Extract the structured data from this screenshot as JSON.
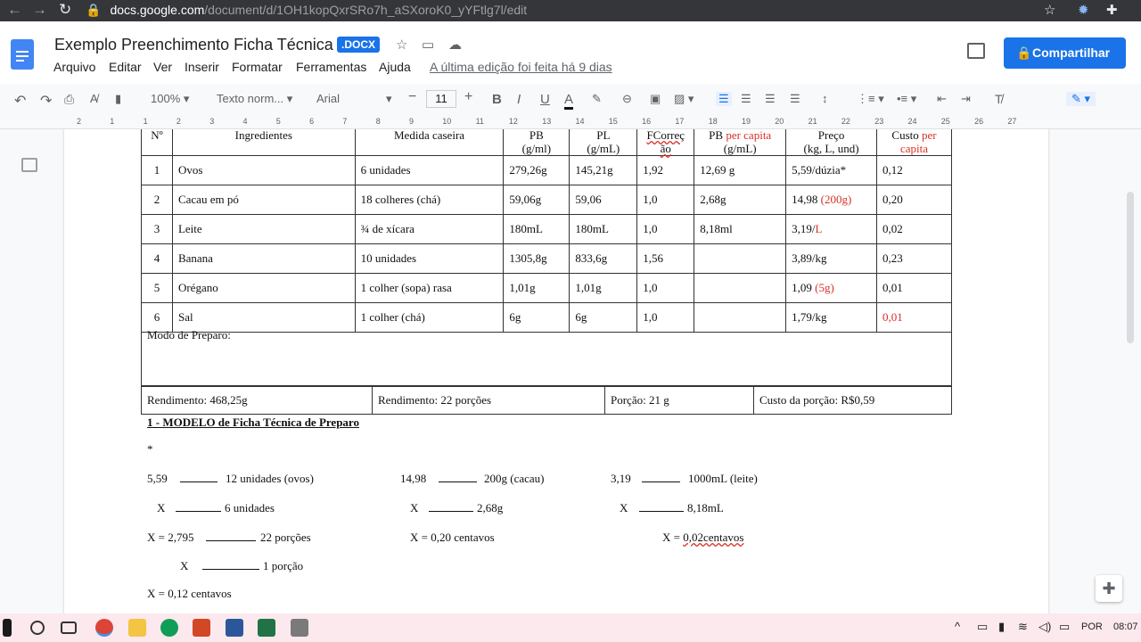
{
  "browser": {
    "url_host": "docs.google.com",
    "url_path": "/document/d/1OH1kopQxrSRo7h_aSXoroK0_yYFtlg7l/edit"
  },
  "doc": {
    "title": "Exemplo Preenchimento Ficha Técnica",
    "badge": ".DOCX",
    "last_edit": "A última edição foi feita há 9 dias",
    "share_label": "Compartilhar"
  },
  "menu": [
    "Arquivo",
    "Editar",
    "Ver",
    "Inserir",
    "Formatar",
    "Ferramentas",
    "Ajuda"
  ],
  "toolbar": {
    "zoom": "100%",
    "style": "Texto norm...",
    "font": "Arial",
    "size": "11"
  },
  "ruler": [
    "2",
    "1",
    "1",
    "2",
    "3",
    "4",
    "5",
    "6",
    "7",
    "8",
    "9",
    "10",
    "11",
    "12",
    "13",
    "14",
    "15",
    "16",
    "17",
    "18",
    "19",
    "20",
    "21",
    "22",
    "23",
    "24",
    "25",
    "26",
    "27"
  ],
  "table": {
    "headers": [
      {
        "a": "Nº",
        "b": ""
      },
      {
        "a": "Ingredientes",
        "b": ""
      },
      {
        "a": "Medida caseira",
        "b": ""
      },
      {
        "a": "PB",
        "b": "(g/ml)"
      },
      {
        "a": "PL",
        "b": "(g/mL)"
      },
      {
        "a": "FCorreç",
        "b": "ão"
      },
      {
        "a": "PB ",
        "red": "per capita",
        "b": "(g/mL)"
      },
      {
        "a": "Preço",
        "b": "(kg, L, und)"
      },
      {
        "a": "Custo ",
        "red": "per",
        "b": "capita"
      }
    ],
    "rows": [
      [
        "1",
        "Ovos",
        "6 unidades",
        "279,26g",
        "145,21g",
        "1,92",
        "12,69 g",
        "5,59/dúzia*",
        "",
        "0,12"
      ],
      [
        "2",
        "Cacau em pó",
        "18 colheres (chá)",
        "59,06g",
        "59,06",
        "1,0",
        "2,68g",
        "14,98 ",
        "(200g)",
        "0,20"
      ],
      [
        "3",
        "Leite",
        "¾  de xícara",
        "180mL",
        "180mL",
        "1,0",
        "8,18ml",
        "3,19/",
        "L",
        "0,02"
      ],
      [
        "4",
        "Banana",
        "10 unidades",
        "1305,8g",
        "833,6g",
        "1,56",
        "",
        "3,89/kg",
        "",
        "0,23"
      ],
      [
        "5",
        "Orégano",
        "1 colher (sopa) rasa",
        "1,01g",
        "1,01g",
        "1,0",
        "",
        "1,09 ",
        "(5g)",
        "0,01"
      ],
      [
        "6",
        "Sal",
        "1 colher (chá)",
        "6g",
        "6g",
        "1,0",
        "",
        "1,79/kg",
        "",
        "0,01"
      ]
    ]
  },
  "modo_preparo": "Modo de Preparo:",
  "rendimento": [
    "Rendimento: 468,25g",
    "Rendimento: 22 porções",
    "Porção: 21 g",
    "Custo da porção: R$0,59"
  ],
  "section_title": "1 - MODELO de Ficha Técnica de Preparo",
  "star": "*",
  "calc": {
    "l1": [
      "5,59",
      "12 unidades (ovos)",
      "14,98",
      "200g (cacau)",
      "3,19",
      "1000mL (leite)"
    ],
    "l2": [
      "X",
      "6 unidades",
      "X",
      "2,68g",
      "X",
      "8,18mL"
    ],
    "l3": [
      "X = 2,795",
      "22 porções",
      "X = 0,20 centavos",
      "X = ",
      "0,02centavos"
    ],
    "l4": [
      "X",
      "1 porção"
    ],
    "l5": "X = 0,12 centavos"
  },
  "taskbar": {
    "lang": "POR",
    "time": "08:07"
  }
}
